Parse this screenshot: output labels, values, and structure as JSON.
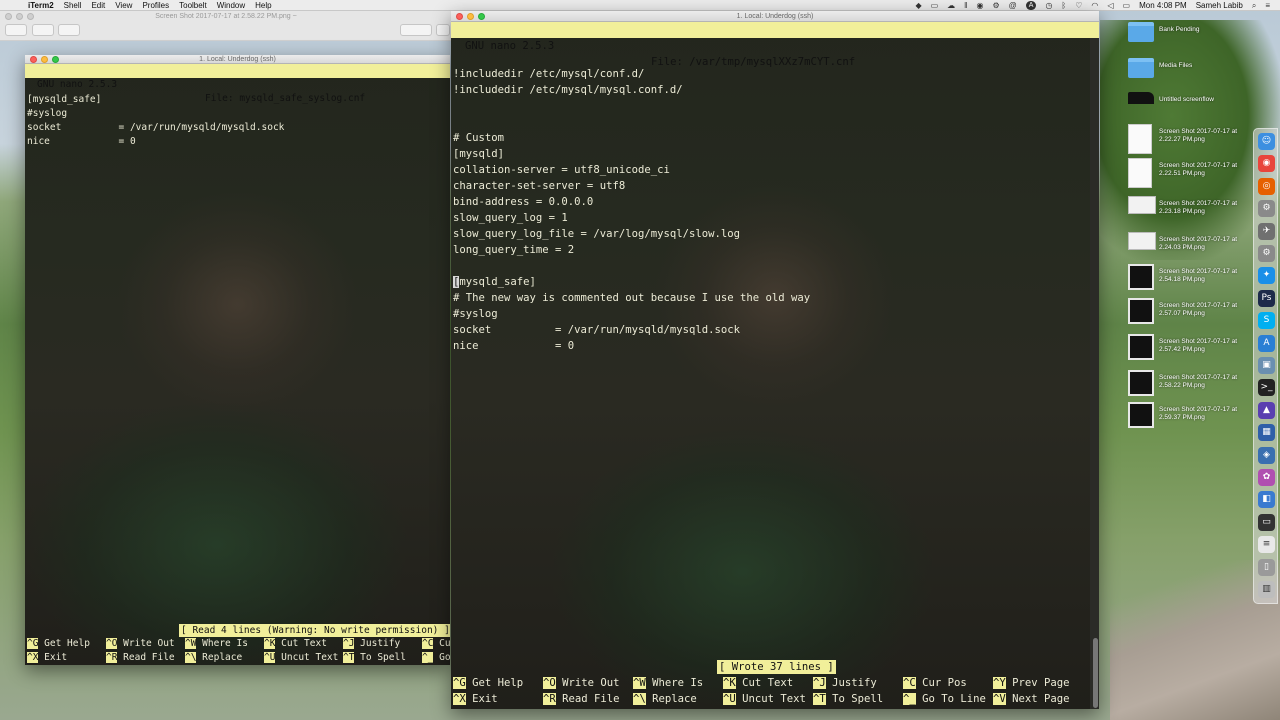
{
  "menubar": {
    "app_name": "iTerm2",
    "items": [
      "Shell",
      "Edit",
      "View",
      "Profiles",
      "Toolbelt",
      "Window",
      "Help"
    ],
    "clock": "Mon 4:08 PM",
    "user": "Sameh Labib"
  },
  "preview_window": {
    "title": "Screen Shot 2017-07-17 at 2.58.22 PM.png ~"
  },
  "left_terminal": {
    "window_title": "1. Local: Underdog (ssh)",
    "nano_version": "GNU nano 2.5.3",
    "file_label": "File: mysqld_safe_syslog.cnf",
    "lines": [
      "[mysqld_safe]",
      "#syslog",
      "socket          = /var/run/mysqld/mysqld.sock",
      "nice            = 0"
    ],
    "status_message": "[ Read 4 lines (Warning: No write permission) ]",
    "shortcuts_row1": [
      {
        "key": "^G",
        "label": "Get Help"
      },
      {
        "key": "^O",
        "label": "Write Out"
      },
      {
        "key": "^W",
        "label": "Where Is"
      },
      {
        "key": "^K",
        "label": "Cut Text"
      },
      {
        "key": "^J",
        "label": "Justify"
      },
      {
        "key": "^C",
        "label": "Cur"
      }
    ],
    "shortcuts_row2": [
      {
        "key": "^X",
        "label": "Exit"
      },
      {
        "key": "^R",
        "label": "Read File"
      },
      {
        "key": "^\\",
        "label": "Replace"
      },
      {
        "key": "^U",
        "label": "Uncut Text"
      },
      {
        "key": "^T",
        "label": "To Spell"
      },
      {
        "key": "^_",
        "label": "Go"
      }
    ]
  },
  "right_terminal": {
    "window_title": "1. Local: Underdog (ssh)",
    "nano_version": "GNU nano 2.5.3",
    "file_label": "File: /var/tmp/mysqlXXz7mCYT.cnf",
    "lines": [
      "!includedir /etc/mysql/conf.d/",
      "!includedir /etc/mysql/mysql.conf.d/",
      "",
      "",
      "# Custom",
      "[mysqld]",
      "collation-server = utf8_unicode_ci",
      "character-set-server = utf8",
      "bind-address = 0.0.0.0",
      "slow_query_log = 1",
      "slow_query_log_file = /var/log/mysql/slow.log",
      "long_query_time = 2",
      "",
      "mysqld_safe]",
      "# The new way is commented out because I use the old way",
      "#syslog",
      "socket          = /var/run/mysqld/mysqld.sock",
      "nice            = 0"
    ],
    "cursor_char": "[",
    "status_message": "[ Wrote 37 lines ]",
    "shortcuts_row1": [
      {
        "key": "^G",
        "label": "Get Help"
      },
      {
        "key": "^O",
        "label": "Write Out"
      },
      {
        "key": "^W",
        "label": "Where Is"
      },
      {
        "key": "^K",
        "label": "Cut Text"
      },
      {
        "key": "^J",
        "label": "Justify"
      },
      {
        "key": "^C",
        "label": "Cur Pos"
      },
      {
        "key": "^Y",
        "label": "Prev Page"
      }
    ],
    "shortcuts_row2": [
      {
        "key": "^X",
        "label": "Exit"
      },
      {
        "key": "^R",
        "label": "Read File"
      },
      {
        "key": "^\\",
        "label": "Replace"
      },
      {
        "key": "^U",
        "label": "Uncut Text"
      },
      {
        "key": "^T",
        "label": "To Spell"
      },
      {
        "key": "^_",
        "label": "Go To Line"
      },
      {
        "key": "^V",
        "label": "Next Page"
      }
    ]
  },
  "desktop_icons": [
    {
      "label": "Bank Pending",
      "kind": "folder"
    },
    {
      "label": "Media Files",
      "kind": "folder"
    },
    {
      "label": "Untitled screenflow",
      "kind": "slate"
    },
    {
      "label": "Screen Shot 2017-07-17 at 2.22.27 PM.png",
      "kind": "doc"
    },
    {
      "label": "Screen Shot 2017-07-17 at 2.22.51 PM.png",
      "kind": "doc"
    },
    {
      "label": "Screen Shot 2017-07-17 at 2.23.18 PM.png",
      "kind": "shot-wide"
    },
    {
      "label": "Screen Shot 2017-07-17 at 2.24.03 PM.png",
      "kind": "shot-wide"
    },
    {
      "label": "Screen Shot 2017-07-17 at 2.54.18 PM.png",
      "kind": "shot"
    },
    {
      "label": "Screen Shot 2017-07-17 at 2.57.07 PM.png",
      "kind": "shot"
    },
    {
      "label": "Screen Shot 2017-07-17 at 2.57.42 PM.png",
      "kind": "shot"
    },
    {
      "label": "Screen Shot 2017-07-17 at 2.58.22 PM.png",
      "kind": "shot"
    },
    {
      "label": "Screen Shot 2017-07-17 at 2.59.37 PM.png",
      "kind": "shot"
    }
  ],
  "dock_apps": [
    {
      "name": "finder-icon",
      "color": "#3d8fe0",
      "glyph": "☺"
    },
    {
      "name": "chrome-icon",
      "color": "#e8453c",
      "glyph": "◉"
    },
    {
      "name": "firefox-icon",
      "color": "#e66000",
      "glyph": "◎"
    },
    {
      "name": "automator-icon",
      "color": "#8a8a8a",
      "glyph": "⚙"
    },
    {
      "name": "launchpad-icon",
      "color": "#707070",
      "glyph": "✈"
    },
    {
      "name": "settings-icon",
      "color": "#8a8a8a",
      "glyph": "⚙"
    },
    {
      "name": "safari-icon",
      "color": "#1a8fe8",
      "glyph": "✦"
    },
    {
      "name": "photoshop-icon",
      "color": "#1d2a4a",
      "glyph": "Ps"
    },
    {
      "name": "skype-icon",
      "color": "#00aff0",
      "glyph": "S"
    },
    {
      "name": "xcode-icon",
      "color": "#2a7fd4",
      "glyph": "A"
    },
    {
      "name": "preview-icon",
      "color": "#6a8fb0",
      "glyph": "▣"
    },
    {
      "name": "terminal-icon",
      "color": "#222222",
      "glyph": ">_"
    },
    {
      "name": "vpn-icon",
      "color": "#5a3fb0",
      "glyph": "▲"
    },
    {
      "name": "virtualbox-icon",
      "color": "#2f5fa8",
      "glyph": "▦"
    },
    {
      "name": "network-icon",
      "color": "#3a6fb0",
      "glyph": "◈"
    },
    {
      "name": "flower-icon",
      "color": "#b04fb0",
      "glyph": "✿"
    },
    {
      "name": "box-icon",
      "color": "#3a7ad0",
      "glyph": "◧"
    },
    {
      "name": "monitor-icon",
      "color": "#333333",
      "glyph": "▭"
    },
    {
      "name": "document-icon",
      "color": "#e8e8e8",
      "glyph": "≡"
    },
    {
      "name": "device-icon",
      "color": "#9a9a9a",
      "glyph": "▯"
    },
    {
      "name": "trash-icon",
      "color": "#bdbdbd",
      "glyph": "▥"
    }
  ]
}
